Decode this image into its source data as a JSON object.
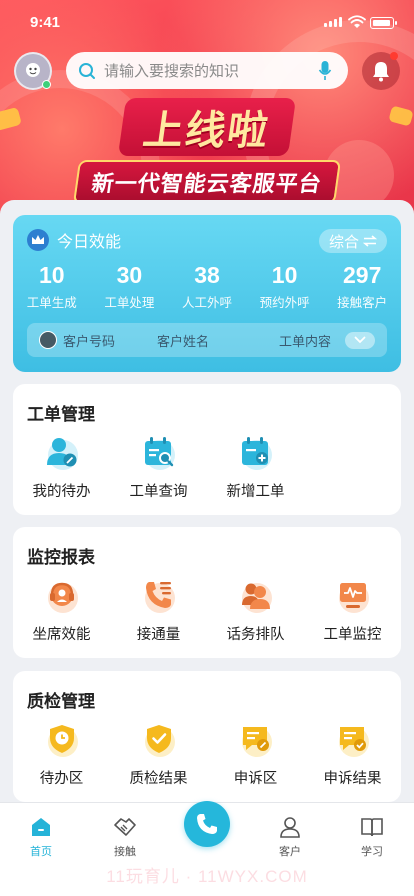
{
  "status_bar": {
    "time": "9:41"
  },
  "search": {
    "placeholder": "请输入要搜索的知识"
  },
  "banner": {
    "line1": "上线啦",
    "line2": "新一代智能云客服平台"
  },
  "stats": {
    "title": "今日效能",
    "mode_label": "综合",
    "metrics": [
      {
        "value": "10",
        "label": "工单生成"
      },
      {
        "value": "30",
        "label": "工单处理"
      },
      {
        "value": "38",
        "label": "人工外呼"
      },
      {
        "value": "10",
        "label": "预约外呼"
      },
      {
        "value": "297",
        "label": "接触客户"
      }
    ],
    "columns": {
      "customer_id": "客户号码",
      "customer_name": "客户姓名",
      "ticket_content": "工单内容"
    }
  },
  "sections": [
    {
      "title": "工单管理",
      "items": [
        {
          "label": "我的待办",
          "icon": "user-edit-icon"
        },
        {
          "label": "工单查询",
          "icon": "calendar-search-icon"
        },
        {
          "label": "新增工单",
          "icon": "calendar-add-icon"
        }
      ]
    },
    {
      "title": "监控报表",
      "items": [
        {
          "label": "坐席效能",
          "icon": "headset-icon"
        },
        {
          "label": "接通量",
          "icon": "phone-list-icon"
        },
        {
          "label": "话务排队",
          "icon": "users-queue-icon"
        },
        {
          "label": "工单监控",
          "icon": "monitor-wave-icon"
        }
      ]
    },
    {
      "title": "质检管理",
      "items": [
        {
          "label": "待办区",
          "icon": "shield-clock-icon"
        },
        {
          "label": "质检结果",
          "icon": "shield-check-icon"
        },
        {
          "label": "申诉区",
          "icon": "chat-edit-icon"
        },
        {
          "label": "申诉结果",
          "icon": "chat-check-icon"
        }
      ]
    }
  ],
  "tabbar": [
    {
      "label": "首页",
      "icon": "home-icon"
    },
    {
      "label": "接触",
      "icon": "handshake-icon"
    },
    {
      "label": "客户",
      "icon": "person-icon"
    },
    {
      "label": "学习",
      "icon": "book-icon"
    }
  ],
  "watermark": "11玩育儿 · 11WYX.COM",
  "colors": {
    "accent": "#25b3d8",
    "hero": "#f23b4d",
    "icon_blue": "#2cb5db",
    "icon_orange": "#f2874a",
    "icon_yellow": "#f5b91e"
  }
}
